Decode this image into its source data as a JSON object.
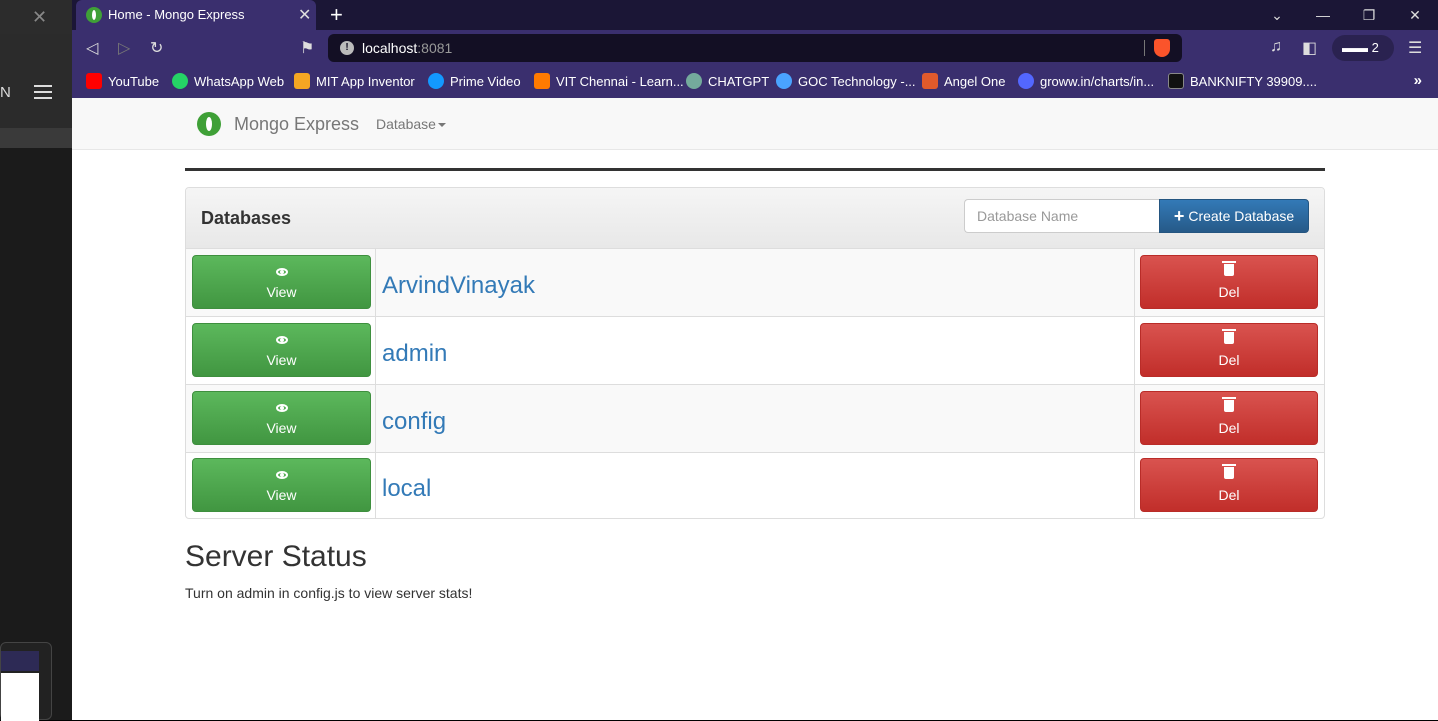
{
  "browser": {
    "tab_title": "Home - Mongo Express",
    "url_host": "localhost",
    "url_port": ":8081",
    "shields_count": "2",
    "bookmarks": [
      {
        "label": "YouTube",
        "color": "#ff0000"
      },
      {
        "label": "WhatsApp Web",
        "color": "#25d366"
      },
      {
        "label": "MIT App Inventor",
        "color": "#f5a623"
      },
      {
        "label": "Prime Video",
        "color": "#1399ff"
      },
      {
        "label": "VIT Chennai - Learn...",
        "color": "#ff7a00"
      },
      {
        "label": "CHATGPT",
        "color": "#74aa9c"
      },
      {
        "label": "GOC Technology -...",
        "color": "#4aa3ff"
      },
      {
        "label": "Angel One",
        "color": "#e05a2b"
      },
      {
        "label": "groww.in/charts/in...",
        "color": "#5367ff"
      },
      {
        "label": "BANKNIFTY 39909....",
        "color": "#111111"
      }
    ]
  },
  "left_pane": {
    "letter": "N"
  },
  "app": {
    "brand": "Mongo Express",
    "db_menu": "Database"
  },
  "panel": {
    "title": "Databases",
    "input_placeholder": "Database Name",
    "create_label": "Create Database",
    "view_label": "View",
    "del_label": "Del",
    "databases": [
      "ArvindVinayak",
      "admin",
      "config",
      "local"
    ]
  },
  "status": {
    "title": "Server Status",
    "text": "Turn on admin in config.js to view server stats!"
  },
  "colors": {
    "brand_green": "#3fa037",
    "link_blue": "#337ab7",
    "view_green": "#5cb85c",
    "del_red": "#d9534f",
    "create_blue": "#337ab7"
  }
}
